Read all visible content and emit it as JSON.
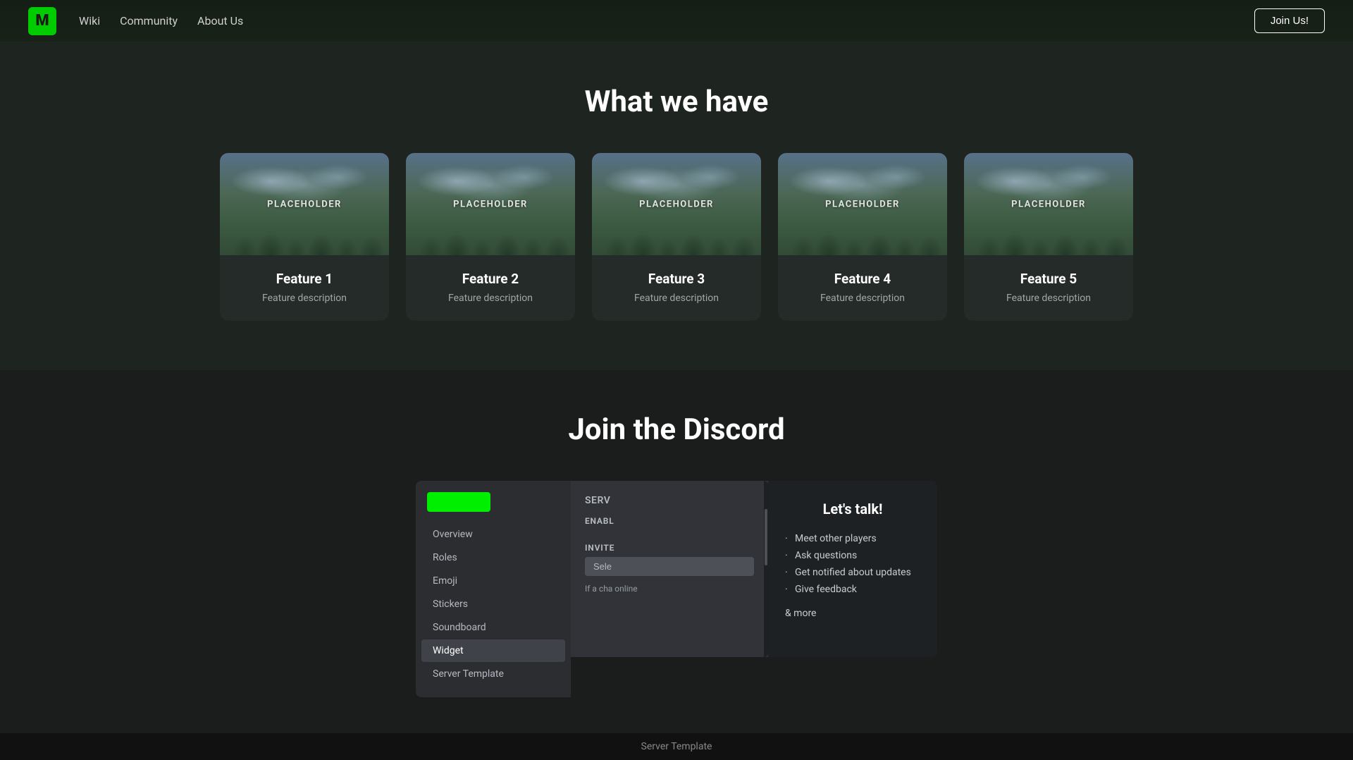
{
  "nav": {
    "logo": "M",
    "links": [
      {
        "id": "wiki",
        "label": "Wiki"
      },
      {
        "id": "community",
        "label": "Community"
      },
      {
        "id": "about",
        "label": "About Us"
      }
    ],
    "join_button": "Join Us!"
  },
  "what_section": {
    "title": "What we have",
    "features": [
      {
        "id": 1,
        "placeholder": "PLACEHOLDER",
        "name": "Feature 1",
        "description": "Feature description"
      },
      {
        "id": 2,
        "placeholder": "PLACEHOLDER",
        "name": "Feature 2",
        "description": "Feature description"
      },
      {
        "id": 3,
        "placeholder": "PLACEHOLDER",
        "name": "Feature 3",
        "description": "Feature description"
      },
      {
        "id": 4,
        "placeholder": "PLACEHOLDER",
        "name": "Feature 4",
        "description": "Feature description"
      },
      {
        "id": 5,
        "placeholder": "PLACEHOLDER",
        "name": "Feature 5",
        "description": "Feature description"
      }
    ]
  },
  "discord_section": {
    "title": "Join the Discord",
    "panel": {
      "menu_items": [
        {
          "id": "overview",
          "label": "Overview",
          "active": false
        },
        {
          "id": "roles",
          "label": "Roles",
          "active": false
        },
        {
          "id": "emoji",
          "label": "Emoji",
          "active": false
        },
        {
          "id": "stickers",
          "label": "Stickers",
          "active": false
        },
        {
          "id": "soundboard",
          "label": "Soundboard",
          "active": false
        },
        {
          "id": "widget",
          "label": "Widget",
          "active": true
        },
        {
          "id": "server-template",
          "label": "Server Template",
          "active": false
        }
      ]
    },
    "main": {
      "title": "Serv",
      "enable_label": "Enabl",
      "invite_label": "INVITE",
      "select_placeholder": "Sele",
      "info_text": "If a cha online"
    },
    "lets_talk": {
      "title": "Let's talk!",
      "items": [
        "Meet other players",
        "Ask questions",
        "Get notified about updates",
        "Give feedback"
      ],
      "more": "& more"
    }
  },
  "footer": {
    "label": "Server Template"
  }
}
